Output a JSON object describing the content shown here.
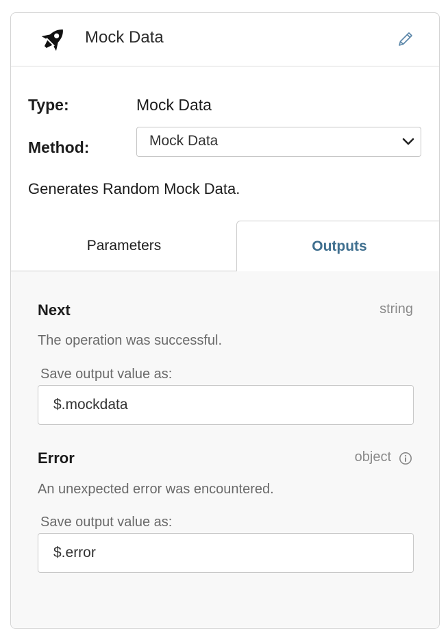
{
  "header": {
    "title": "Mock Data",
    "icon": "rocket-icon",
    "edit_icon": "pencil-icon"
  },
  "fields": {
    "type_label": "Type:",
    "type_value": "Mock Data",
    "method_label": "Method:",
    "method_selected": "Mock Data"
  },
  "description": "Generates Random Mock Data.",
  "tabs": [
    {
      "label": "Parameters",
      "active": false
    },
    {
      "label": "Outputs",
      "active": true
    }
  ],
  "outputs": [
    {
      "name": "Next",
      "type": "string",
      "description": "The operation was successful.",
      "save_label": "Save output value as:",
      "value": "$.mockdata"
    },
    {
      "name": "Error",
      "type": "object",
      "description": "An unexpected error was encountered.",
      "save_label": "Save output value as:",
      "value": "$.error"
    }
  ],
  "colors": {
    "active_tab": "#3f6f8f",
    "border": "#d4d4d4"
  }
}
